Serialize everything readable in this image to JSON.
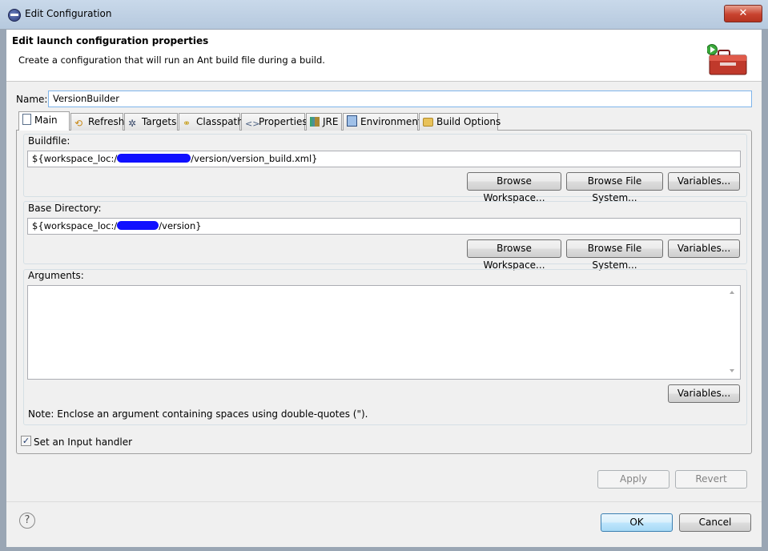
{
  "window": {
    "title": "Edit Configuration",
    "close_label": "✕"
  },
  "header": {
    "title": "Edit launch configuration properties",
    "description": "Create a configuration that will run an Ant build file during a build."
  },
  "name_field": {
    "label": "Name:",
    "value": "VersionBuilder"
  },
  "tabs": [
    {
      "label": "Main",
      "active": true,
      "icon": "page-icon"
    },
    {
      "label": "Refresh",
      "active": false,
      "icon": "refresh-icon"
    },
    {
      "label": "Targets",
      "active": false,
      "icon": "targets-icon"
    },
    {
      "label": "Classpath",
      "active": false,
      "icon": "classpath-icon"
    },
    {
      "label": "Properties",
      "active": false,
      "icon": "properties-icon"
    },
    {
      "label": "JRE",
      "active": false,
      "icon": "jre-icon"
    },
    {
      "label": "Environment",
      "active": false,
      "icon": "environment-icon"
    },
    {
      "label": "Build Options",
      "active": false,
      "icon": "folder-icon"
    }
  ],
  "buildfile": {
    "label": "Buildfile:",
    "value_prefix": "${workspace_loc:/",
    "value_suffix": "/version/version_build.xml}",
    "browse_workspace": "Browse Workspace...",
    "browse_filesystem": "Browse File System...",
    "variables": "Variables..."
  },
  "base_directory": {
    "label": "Base Directory:",
    "value_prefix": "${workspace_loc:/",
    "value_suffix": "/version}",
    "browse_workspace": "Browse Workspace...",
    "browse_filesystem": "Browse File System...",
    "variables": "Variables..."
  },
  "arguments": {
    "label": "Arguments:",
    "value": "",
    "variables": "Variables...",
    "note": "Note: Enclose an argument containing spaces using double-quotes (\")."
  },
  "input_handler": {
    "label": "Set an Input handler",
    "checked": true
  },
  "actions": {
    "apply": "Apply",
    "revert": "Revert"
  },
  "footer": {
    "ok": "OK",
    "cancel": "Cancel",
    "help_glyph": "?"
  },
  "colors": {
    "redaction": "#1010ff",
    "title_bar": "#c9d9ea",
    "close_button": "#c8422e"
  }
}
